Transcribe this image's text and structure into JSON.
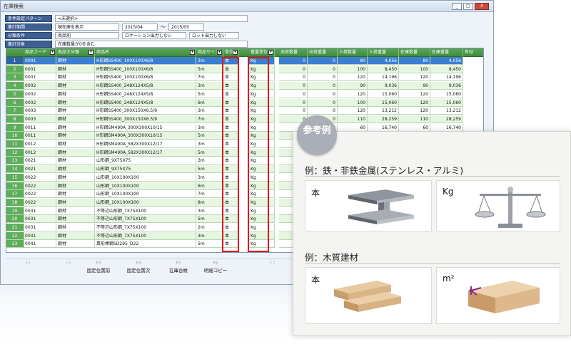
{
  "window": {
    "title": "在庫検索",
    "buttons": [
      "_",
      "□",
      "X"
    ]
  },
  "conditions": {
    "pattern": {
      "label": "条件設定パターン",
      "value": "<未選択>"
    },
    "period": {
      "label": "集計期間",
      "mode": "現在庫を表示",
      "from": "2015/04",
      "separator": "〜",
      "to": "2015/05"
    },
    "category": {
      "label": "分類条件",
      "value": "商品別",
      "option1": "ロケーション出力しない",
      "option2": "ロット出力しない"
    },
    "target": {
      "label": "集計対象",
      "value": "在庫数量が0を含む"
    }
  },
  "grid": {
    "columns": [
      "商品コード",
      "商品大分類",
      "商品名",
      "商品サイズ",
      "単位",
      "重量単位",
      "出荷数量",
      "出荷重量",
      "入荷数量",
      "入荷重量",
      "在庫数量",
      "在庫重量",
      "有効"
    ],
    "rows": [
      [
        "1",
        "0001",
        "鋼材",
        "H形鋼SS400_100X100X6/8",
        "3m",
        "本",
        "Kg",
        "0",
        "0",
        "80",
        "4,056",
        "80",
        "4,056"
      ],
      [
        "2",
        "0001",
        "鋼材",
        "H形鋼SS400_100X100X6/8",
        "5m",
        "本",
        "Kg",
        "0",
        "0",
        "100",
        "8,450",
        "100",
        "8,450"
      ],
      [
        "3",
        "0001",
        "鋼材",
        "H形鋼SS400_100X100X6/8",
        "7m",
        "本",
        "Kg",
        "0",
        "0",
        "120",
        "14,196",
        "120",
        "14,196"
      ],
      [
        "4",
        "0002",
        "鋼材",
        "H形鋼SS400_248X124X5/8",
        "3m",
        "本",
        "Kg",
        "0",
        "0",
        "90",
        "9,036",
        "90",
        "9,036"
      ],
      [
        "5",
        "0002",
        "鋼材",
        "H形鋼SS400_248X124X5/8",
        "5m",
        "本",
        "Kg",
        "0",
        "0",
        "120",
        "15,060",
        "120",
        "15,060"
      ],
      [
        "6",
        "0002",
        "鋼材",
        "H形鋼SS400_248X124X5/8",
        "6m",
        "本",
        "Kg",
        "0",
        "0",
        "100",
        "15,060",
        "120",
        "15,060"
      ],
      [
        "7",
        "0003",
        "鋼材",
        "H形鋼SS400_300X150X6.5/9",
        "3m",
        "本",
        "Kg",
        "0",
        "0",
        "120",
        "13,212",
        "120",
        "13,212"
      ],
      [
        "8",
        "0003",
        "鋼材",
        "H形鋼SS400_300X150X6.5/9",
        "7m",
        "本",
        "Kg",
        "0",
        "0",
        "110",
        "28,259",
        "110",
        "28,259"
      ],
      [
        "9",
        "0011",
        "鋼材",
        "H形鋼SM490A_300X300X10/15",
        "3m",
        "本",
        "Kg",
        "0",
        "0",
        "60",
        "16,740",
        "60",
        "16,740"
      ],
      [
        "10",
        "0011",
        "鋼材",
        "H形鋼SM490A_300X300X10/15",
        "5m",
        "本",
        "Kg",
        "",
        "",
        "",
        "",
        "",
        ""
      ],
      [
        "11",
        "0012",
        "鋼材",
        "H形鋼SM490A_582X300X12/17",
        "3m",
        "本",
        "Kg",
        "",
        "",
        "",
        "",
        "",
        ""
      ],
      [
        "12",
        "0012",
        "鋼材",
        "H形鋼SM490A_582X300X12/17",
        "5m",
        "本",
        "Kg",
        "",
        "",
        "",
        "",
        "",
        ""
      ],
      [
        "13",
        "0021",
        "鋼材",
        "山形鋼_9X75X75",
        "3m",
        "本",
        "Kg",
        "",
        "",
        "",
        "",
        "",
        ""
      ],
      [
        "14",
        "0021",
        "鋼材",
        "山形鋼_9X75X75",
        "5m",
        "本",
        "Kg",
        "",
        "",
        "",
        "",
        "",
        ""
      ],
      [
        "15",
        "0022",
        "鋼材",
        "山形鋼_10X100X100",
        "3m",
        "本",
        "Kg",
        "",
        "",
        "",
        "",
        "",
        ""
      ],
      [
        "16",
        "0022",
        "鋼材",
        "山形鋼_10X100X100",
        "6m",
        "本",
        "Kg",
        "",
        "",
        "",
        "",
        "",
        ""
      ],
      [
        "17",
        "0022",
        "鋼材",
        "山形鋼_10X100X100",
        "7m",
        "本",
        "Kg",
        "",
        "",
        "",
        "",
        "",
        ""
      ],
      [
        "18",
        "0022",
        "鋼材",
        "山形鋼_10X100X100",
        "8m",
        "本",
        "Kg",
        "",
        "",
        "",
        "",
        "",
        ""
      ],
      [
        "19",
        "0031",
        "鋼材",
        "不等辺山形鋼_7X75X100",
        "3m",
        "本",
        "Kg",
        "",
        "",
        "",
        "",
        "",
        ""
      ],
      [
        "20",
        "0031",
        "鋼材",
        "不等辺山形鋼_7X75X100",
        "5m",
        "本",
        "Kg",
        "",
        "",
        "",
        "",
        "",
        ""
      ],
      [
        "21",
        "0031",
        "鋼材",
        "不等辺山形鋼_7X75X100",
        "2m",
        "本",
        "Kg",
        "",
        "",
        "",
        "",
        "",
        ""
      ],
      [
        "22",
        "0031",
        "鋼材",
        "不等辺山形鋼_7X75X100",
        "3m",
        "本",
        "Kg",
        "",
        "",
        "",
        "",
        "",
        ""
      ],
      [
        "23",
        "0041",
        "鋼材",
        "異形棒鋼SD295_D22",
        "5m",
        "本",
        "Kg",
        "",
        "",
        "",
        "",
        "",
        ""
      ]
    ]
  },
  "fkeys": [
    {
      "key": "F1",
      "label": ""
    },
    {
      "key": "F2",
      "label": ""
    },
    {
      "key": "F3",
      "label": "固定位置前"
    },
    {
      "key": "F4",
      "label": "固定位置次"
    },
    {
      "key": "F5",
      "label": "在庫台帳"
    },
    {
      "key": "F6",
      "label": "明細コピー"
    },
    {
      "key": "F7",
      "label": ""
    }
  ],
  "reference": {
    "badge": "参考例",
    "example1": {
      "title": "例：鉄・非鉄金属(ステンレス・アルミ)",
      "unit": "本",
      "weight": "Kg",
      "unit_icon": "h-beam-icon",
      "weight_icon": "balance-scale-icon"
    },
    "example2": {
      "title": "例：木質建材",
      "unit": "本",
      "weight": "m²",
      "unit_icon": "lumber-icon",
      "weight_icon": "wood-volume-icon"
    }
  },
  "colors": {
    "header": "#4a9a47",
    "row_alt": "#e6f6e1",
    "selected": "#3c7fd0",
    "highlight": "#e0161d",
    "label": "#3d5f93"
  }
}
